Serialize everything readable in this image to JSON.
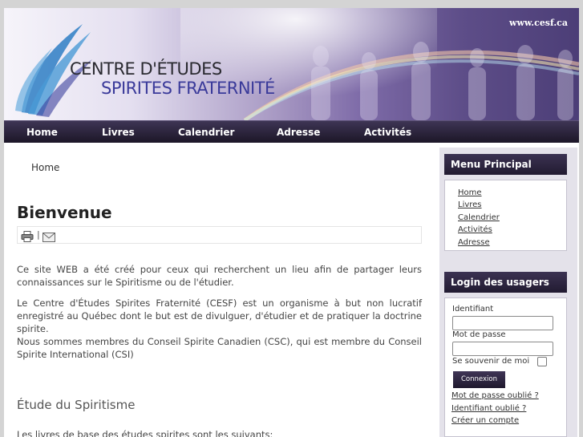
{
  "header": {
    "site_url": "www.cesf.ca",
    "title_line1": "CENTRE D'ÉTUDES",
    "title_line2": "SPIRITES FRATERNITÉ"
  },
  "nav": {
    "items": [
      {
        "label": "Home"
      },
      {
        "label": "Livres"
      },
      {
        "label": "Calendrier"
      },
      {
        "label": "Adresse"
      },
      {
        "label": "Activités"
      }
    ]
  },
  "main": {
    "breadcrumb": "Home",
    "title": "Bienvenue",
    "toolbar_separator": "|",
    "paragraphs": [
      "Ce site WEB a été créé pour ceux qui recherchent un lieu afin de partager leurs connaissances sur le Spiritisme ou de l'étudier.",
      "Le Centre d'Études Spirites Fraternité (CESF) est un organisme à but non lucratif enregistré au Québec dont le but est de divulguer, d'étudier et de pratiquer la doctrine spirite.",
      "Nous sommes membres du Conseil Spirite Canadien (CSC), qui est membre du Conseil Spirite International (CSI)"
    ],
    "section_heading": "Étude du Spiritisme",
    "section_text": "Les livres de base des études spirites sont les suivants:"
  },
  "sidebar": {
    "menu": {
      "title": "Menu Principal",
      "items": [
        {
          "label": "Home"
        },
        {
          "label": "Livres"
        },
        {
          "label": "Calendrier"
        },
        {
          "label": "Activités"
        },
        {
          "label": "Adresse"
        }
      ]
    },
    "login": {
      "title": "Login des usagers",
      "username_label": "Identifiant",
      "password_label": "Mot de passe",
      "remember_label": "Se souvenir de moi",
      "submit_label": "Connexion",
      "forgot_password": "Mot de passe oublié ?",
      "forgot_username": "Identifiant oublié ?",
      "create_account": "Créer un compte"
    }
  },
  "colors": {
    "nav_bg": "#241d33",
    "module_title_bg": "#2e2642",
    "sidebar_bg": "#e4e2ea"
  },
  "icons": [
    "logo-swoosh-icon",
    "print-icon",
    "email-icon"
  ]
}
